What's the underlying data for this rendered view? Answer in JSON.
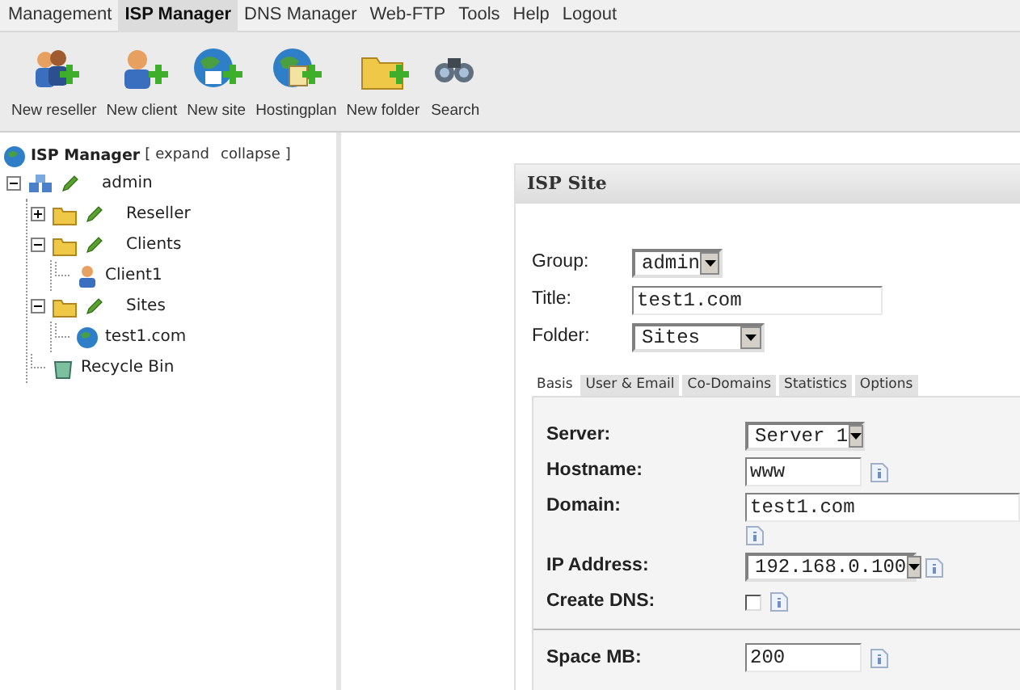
{
  "menu": [
    {
      "label": "Management",
      "selected": false
    },
    {
      "label": "ISP Manager",
      "selected": true
    },
    {
      "label": "DNS Manager",
      "selected": false
    },
    {
      "label": "Web-FTP",
      "selected": false
    },
    {
      "label": "Tools",
      "selected": false
    },
    {
      "label": "Help",
      "selected": false
    },
    {
      "label": "Logout",
      "selected": false
    }
  ],
  "toolbar": [
    {
      "label": "New reseller",
      "kind": "reseller"
    },
    {
      "label": "New client",
      "kind": "client"
    },
    {
      "label": "New site",
      "kind": "site"
    },
    {
      "label": "Hostingplan",
      "kind": "plan"
    },
    {
      "label": "New folder",
      "kind": "folder"
    },
    {
      "label": "Search",
      "kind": "search"
    }
  ],
  "tree": {
    "title": "ISP Manager",
    "bracket_open": "[",
    "expand": "expand",
    "collapse": "collapse",
    "bracket_close": "]",
    "nodes": [
      {
        "label": "admin",
        "kind": "group",
        "expanded": true,
        "children": [
          {
            "label": "Reseller",
            "kind": "folder",
            "expanded": false
          },
          {
            "label": "Clients",
            "kind": "folder",
            "expanded": true,
            "children": [
              {
                "label": "Client1",
                "kind": "user"
              }
            ]
          },
          {
            "label": "Sites",
            "kind": "folder",
            "expanded": true,
            "children": [
              {
                "label": "test1.com",
                "kind": "site"
              }
            ]
          },
          {
            "label": "Recycle Bin",
            "kind": "trash"
          }
        ]
      }
    ]
  },
  "panel": {
    "title": "ISP Site",
    "fields": [
      {
        "label": "Group:",
        "kind": "select",
        "value": "admin"
      },
      {
        "label": "Title:",
        "kind": "text",
        "value": "test1.com"
      },
      {
        "label": "Folder:",
        "kind": "select",
        "value": "Sites"
      }
    ],
    "tabs": [
      {
        "label": "Basis",
        "selected": true
      },
      {
        "label": "User & Email",
        "selected": false
      },
      {
        "label": "Co-Domains",
        "selected": false
      },
      {
        "label": "Statistics",
        "selected": false
      },
      {
        "label": "Options",
        "selected": false
      }
    ],
    "rows": [
      {
        "kind": "select",
        "label": "Server:",
        "value": "Server 1",
        "help": false
      },
      {
        "kind": "text",
        "label": "Hostname:",
        "value": "www",
        "help": true
      },
      {
        "kind": "wide",
        "label": "Domain:",
        "value": "test1.com",
        "help": true
      },
      {
        "kind": "select",
        "label": "IP Address:",
        "value": "192.168.0.100",
        "help": true
      },
      {
        "kind": "checkbox",
        "label": "Create DNS:",
        "checked": false,
        "help": true
      },
      {
        "kind": "separator"
      },
      {
        "kind": "text",
        "label": "Space MB:",
        "value": "200",
        "help": true
      }
    ]
  }
}
